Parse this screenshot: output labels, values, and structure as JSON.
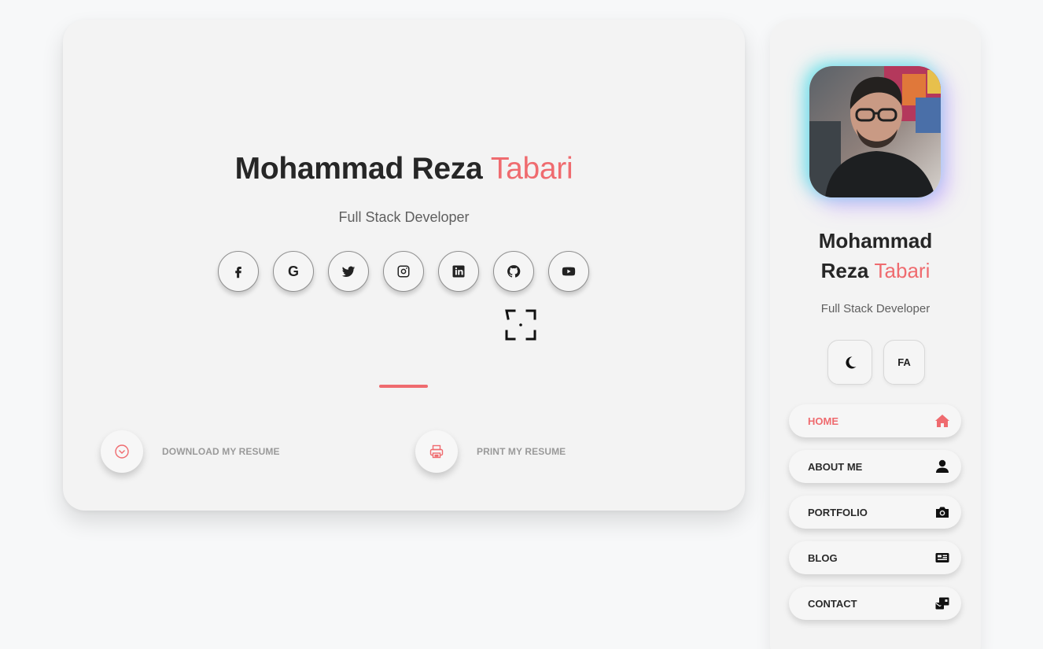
{
  "hero": {
    "first_name": "Mohammad Reza",
    "last_name": "Tabari",
    "role": "Full Stack Developer"
  },
  "social_icons": [
    "facebook-icon",
    "google-icon",
    "twitter-icon",
    "instagram-icon",
    "linkedin-icon",
    "github-icon",
    "youtube-icon"
  ],
  "actions": {
    "download_label": "DOWNLOAD MY RESUME",
    "print_label": "PRINT MY RESUME"
  },
  "sidebar": {
    "name_line1": "Mohammad",
    "name_line2_first": "Reza",
    "name_line2_accent": "Tabari",
    "role": "Full Stack Developer",
    "lang_toggle": "FA",
    "nav": [
      {
        "label": "HOME",
        "icon": "home-icon",
        "active": true
      },
      {
        "label": "ABOUT ME",
        "icon": "user-icon",
        "active": false
      },
      {
        "label": "PORTFOLIO",
        "icon": "camera-icon",
        "active": false
      },
      {
        "label": "BLOG",
        "icon": "newspaper-icon",
        "active": false
      },
      {
        "label": "CONTACT",
        "icon": "mail-bulk-icon",
        "active": false
      }
    ]
  },
  "colors": {
    "accent": "#ef6b6f",
    "card": "#f3f3f3",
    "background": "#f7f8f9"
  }
}
